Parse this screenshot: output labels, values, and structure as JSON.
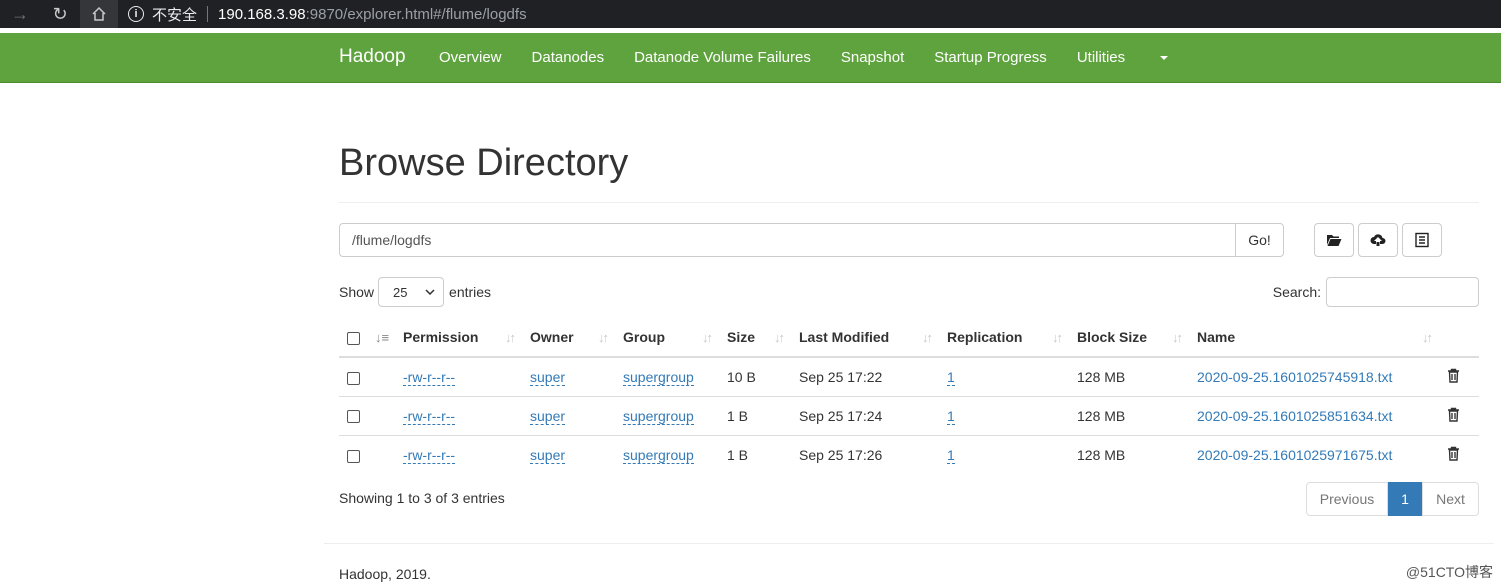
{
  "browser": {
    "insecure_label": "不安全",
    "url_host": "190.168.3.98",
    "url_rest": ":9870/explorer.html#/flume/logdfs"
  },
  "navbar": {
    "brand": "Hadoop",
    "links": [
      "Overview",
      "Datanodes",
      "Datanode Volume Failures",
      "Snapshot",
      "Startup Progress"
    ],
    "utilities": "Utilities",
    "bg_color": "#5fa33e"
  },
  "page": {
    "title": "Browse Directory",
    "path_value": "/flume/logdfs",
    "go_label": "Go!"
  },
  "controls": {
    "show_label": "Show",
    "entries_value": "25",
    "entries_label": "entries",
    "search_label": "Search:"
  },
  "table": {
    "headers": [
      "Permission",
      "Owner",
      "Group",
      "Size",
      "Last Modified",
      "Replication",
      "Block Size",
      "Name"
    ],
    "rows": [
      {
        "permission": "-rw-r--r--",
        "owner": "super",
        "group": "supergroup",
        "size": "10 B",
        "modified": "Sep 25 17:22",
        "replication": "1",
        "block_size": "128 MB",
        "name": "2020-09-25.1601025745918.txt"
      },
      {
        "permission": "-rw-r--r--",
        "owner": "super",
        "group": "supergroup",
        "size": "1 B",
        "modified": "Sep 25 17:24",
        "replication": "1",
        "block_size": "128 MB",
        "name": "2020-09-25.1601025851634.txt"
      },
      {
        "permission": "-rw-r--r--",
        "owner": "super",
        "group": "supergroup",
        "size": "1 B",
        "modified": "Sep 25 17:26",
        "replication": "1",
        "block_size": "128 MB",
        "name": "2020-09-25.1601025971675.txt"
      }
    ]
  },
  "pagination": {
    "info": "Showing 1 to 3 of 3 entries",
    "previous": "Previous",
    "current": "1",
    "next": "Next"
  },
  "footer": {
    "text": "Hadoop, 2019.",
    "watermark": "@51CTO博客"
  }
}
